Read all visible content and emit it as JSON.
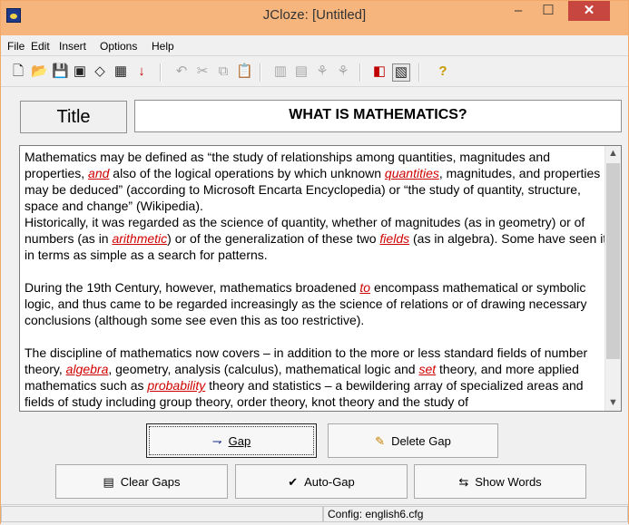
{
  "window": {
    "title": "JCloze: [Untitled]",
    "minimize_glyph": "–",
    "maximize_glyph": "☐",
    "close_glyph": "✕"
  },
  "menu": {
    "items": [
      "File",
      "Edit",
      "Insert",
      "Options",
      "Help"
    ]
  },
  "toolbar": {
    "icons": [
      "new-document-icon",
      "open-folder-icon",
      "save-icon",
      "save-as-icon",
      "eraser-icon",
      "grid-icon",
      "arrow-down-icon",
      "undo-icon",
      "cut-icon",
      "copy-icon",
      "paste-icon",
      "gap-tools-icon",
      "word-list-icon",
      "tree-icon",
      "alt-tree-icon",
      "web-page-icon",
      "export-icon",
      "help-icon"
    ]
  },
  "title_section": {
    "label": "Title",
    "value": "WHAT IS MATHEMATICS?"
  },
  "content": {
    "p1": {
      "a": "Mathematics may be defined as “the study of relationships among quantities, magnitudes and properties, ",
      "gap1": "and",
      "b": " also of the logical operations by which unknown ",
      "gap2": "quantities",
      "c": ", magnitudes, and properties may be deduced” (according to Microsoft Encarta Encyclopedia) or “the study of quantity, structure, space and change” (Wikipedia).",
      "d": "Historically, it was regarded as the science of quantity, whether of magnitudes (as in geometry) or of numbers (as in ",
      "gap3": "arithmetic",
      "e": ") or of the generalization of these two ",
      "gap4": "fields",
      "f": " (as in algebra). Some have seen it in terms as simple as a search for patterns."
    },
    "p2": {
      "a": "During the 19th Century, however, mathematics broadened ",
      "gap1": "to",
      "b": " encompass mathematical or symbolic logic, and thus came to be regarded increasingly as the science of relations or of drawing necessary conclusions (although some see even this as too restrictive)."
    },
    "p3": {
      "a": "The discipline of mathematics now covers – in addition to the more or less standard fields of number theory, ",
      "gap1": "algebra",
      "b": ", geometry, analysis (calculus), mathematical logic and ",
      "gap2": "set",
      "c": " theory, and more applied mathematics such as ",
      "gap3": "probability",
      "d": " theory and statistics – a bewildering array of"
    },
    "p3_cutoff": "specialized areas and fields of study including group theory, order theory, knot theory and the study of"
  },
  "buttons": {
    "gap": "Gap",
    "delete_gap": "Delete Gap",
    "clear_gaps": "Clear Gaps",
    "auto_gap": "Auto-Gap",
    "show_words": "Show Words"
  },
  "status": {
    "config": "Config: english6.cfg"
  },
  "colors": {
    "titlebar": "#f7b57e",
    "gap_text": "#d00000"
  }
}
